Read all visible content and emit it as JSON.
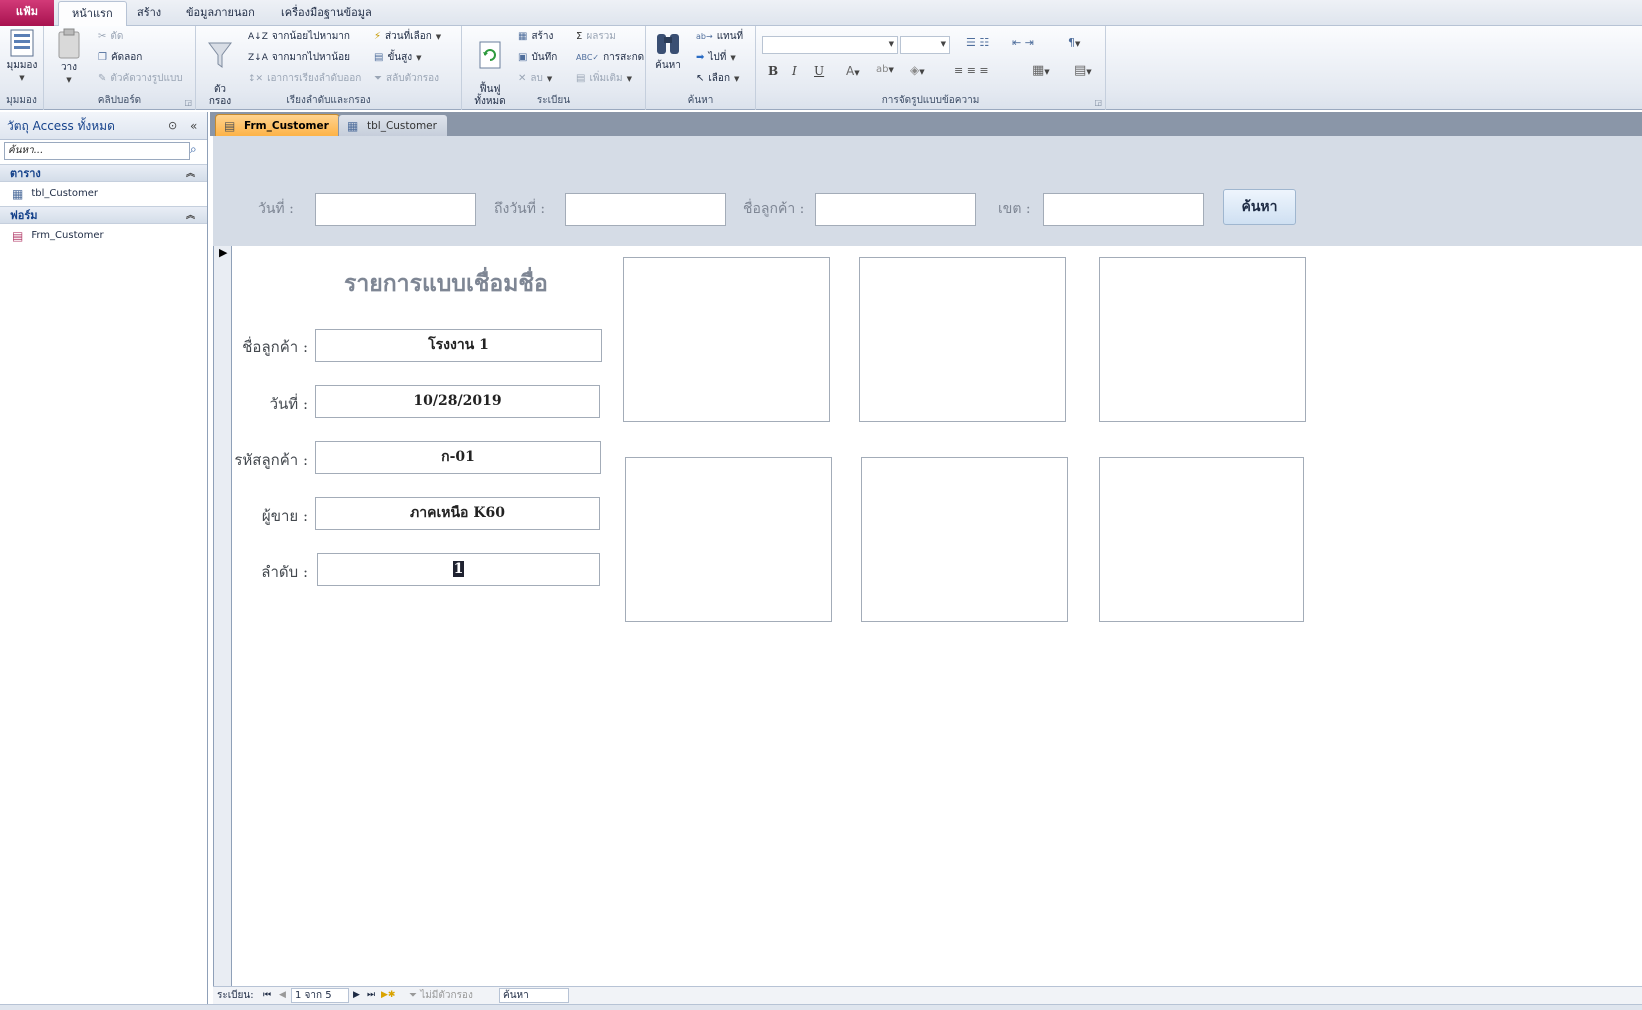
{
  "ribbon": {
    "tabs": {
      "file": "แฟ้ม",
      "home": "หน้าแรก",
      "create": "สร้าง",
      "external": "ข้อมูลภายนอก",
      "dbtools": "เครื่องมือฐานข้อมูล"
    },
    "views": {
      "view": "มุมมอง",
      "group": "มุมมอง"
    },
    "clipboard": {
      "paste": "วาง",
      "cut": "ตัด",
      "copy": "คัดลอก",
      "format_painter": "ตัวคัดวางรูปแบบ",
      "group": "คลิปบอร์ด"
    },
    "sort_filter": {
      "filter": "ตัว\nกรอง",
      "ascending": "จากน้อยไปหามาก",
      "descending": "จากมากไปหาน้อย",
      "remove_sort": "เอาการเรียงลำดับออก",
      "selection": "ส่วนที่เลือก",
      "advanced": "ขั้นสูง",
      "toggle_filter": "สลับตัวกรอง",
      "group": "เรียงลำดับและกรอง"
    },
    "records": {
      "refresh": "ฟื้นฟู\nทั้งหมด",
      "new": "สร้าง",
      "save": "บันทึก",
      "delete": "ลบ",
      "totals": "ผลรวม",
      "spelling": "การสะกด",
      "more": "เพิ่มเติม",
      "group": "ระเบียน"
    },
    "find": {
      "find": "ค้นหา",
      "replace": "แทนที่",
      "goto": "ไปที่",
      "select": "เลือก",
      "group": "ค้นหา"
    },
    "text_format": {
      "group": "การจัดรูปแบบข้อความ",
      "bold": "B",
      "italic": "I",
      "underline": "U"
    }
  },
  "nav": {
    "header": "วัตถุ Access ทั้งหมด",
    "search_placeholder": "ค้นหา...",
    "groups": [
      {
        "label": "ตาราง",
        "items": [
          "tbl_Customer"
        ]
      },
      {
        "label": "ฟอร์ม",
        "items": [
          "Frm_Customer"
        ]
      }
    ]
  },
  "doc_tabs": [
    "Frm_Customer",
    "tbl_Customer"
  ],
  "form_header": {
    "date_label": "วันที่ :",
    "to_date_label": "ถึงวันที่ :",
    "customer_label": "ชื่อลูกค้า :",
    "zone_label": "เขต :",
    "search_button": "ค้นหา"
  },
  "detail": {
    "title": "รายการแบบเชื่อมชื่อ",
    "fields": [
      {
        "label": "ชื่อลูกค้า :",
        "value": "โรงงาน 1"
      },
      {
        "label": "วันที่ :",
        "value": "10/28/2019"
      },
      {
        "label": "รหัสลูกค้า :",
        "value": "ก-01"
      },
      {
        "label": "ผู้ขาย :",
        "value": "ภาคเหนือ K60"
      },
      {
        "label": "ลำดับ :",
        "value": "1"
      }
    ]
  },
  "record_nav": {
    "label": "ระเบียน:",
    "position": "1 จาก 5",
    "no_filter": "ไม่มีตัวกรอง",
    "search": "ค้นหา"
  }
}
